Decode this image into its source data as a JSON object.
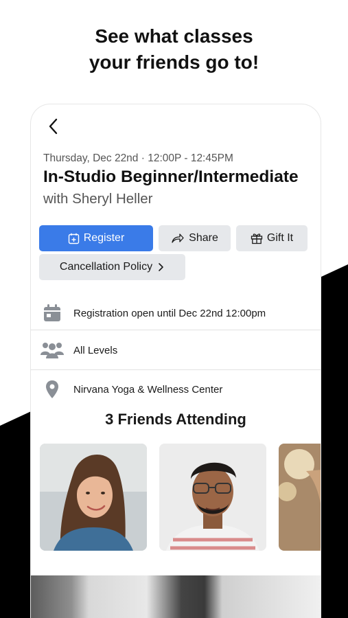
{
  "headline": {
    "line1": "See what classes",
    "line2": "your friends go to!"
  },
  "class": {
    "datetime": "Thursday, Dec 22nd · 12:00P - 12:45PM",
    "title": "In-Studio Beginner/Intermediate",
    "instructor": "with Sheryl Heller"
  },
  "actions": {
    "register": "Register",
    "share": "Share",
    "gift": "Gift It",
    "cancellation": "Cancellation Policy"
  },
  "info": {
    "registration": "Registration open until Dec 22nd 12:00pm",
    "level": "All Levels",
    "location": "Nirvana Yoga & Wellness Center"
  },
  "friends": {
    "title": "3 Friends Attending"
  },
  "colors": {
    "accent": "#3a7be8",
    "icon_gray": "#8a8f96",
    "button_gray": "#e6e8eb"
  },
  "icons": [
    "back-chevron-icon",
    "calendar-plus-icon",
    "share-arrow-icon",
    "gift-icon",
    "chevron-right-icon",
    "calendar-icon",
    "people-icon",
    "location-pin-icon"
  ]
}
